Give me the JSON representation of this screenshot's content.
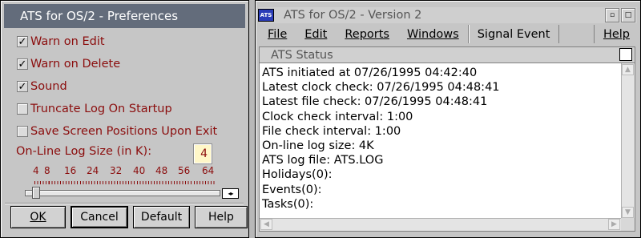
{
  "prefs": {
    "title": "ATS for OS/2 - Preferences",
    "options": [
      {
        "label": "Warn on Edit",
        "checked": true
      },
      {
        "label": "Warn on Delete",
        "checked": true
      },
      {
        "label": "Sound",
        "checked": true
      },
      {
        "label": "Truncate Log On Startup",
        "checked": false
      },
      {
        "label": "Save Screen Positions Upon Exit",
        "checked": false
      }
    ],
    "log_size_label": "On-Line Log Size (in K):",
    "log_size_value": "4",
    "scale_labels": [
      "4",
      "8",
      "16",
      "24",
      "32",
      "40",
      "48",
      "56",
      "64"
    ],
    "slider_level": 4,
    "slider_arrows": "◂▸",
    "buttons": {
      "ok": "OK",
      "cancel": "Cancel",
      "default": "Default",
      "help": "Help"
    }
  },
  "main": {
    "app_icon": "ATS",
    "title": "ATS for OS/2 - Version 2",
    "restore_glyph": "▫",
    "menu": [
      "File",
      "Edit",
      "Reports",
      "Windows",
      "Signal Event",
      "Help"
    ],
    "status_title": "ATS Status",
    "status_lines": [
      "ATS initiated at 07/26/1995 04:42:40",
      "Latest clock check: 07/26/1995 04:48:41",
      "Latest file check: 07/26/1995 04:48:41",
      "Clock check interval: 1:00",
      "File check interval: 1:00",
      "On-line log size: 4K",
      "ATS log file: ATS.LOG",
      "Holidays(0):",
      "Events(0):",
      "Tasks(0):"
    ],
    "scroll_glyphs": {
      "up": "▲",
      "down": "▼",
      "left": "◀",
      "right": "▶"
    }
  },
  "colors": {
    "label_text": "#8b0d0d",
    "active_title": "#636c7b",
    "inactive_title": "#cfcfcf",
    "app_icon": "#2a3cb8"
  }
}
